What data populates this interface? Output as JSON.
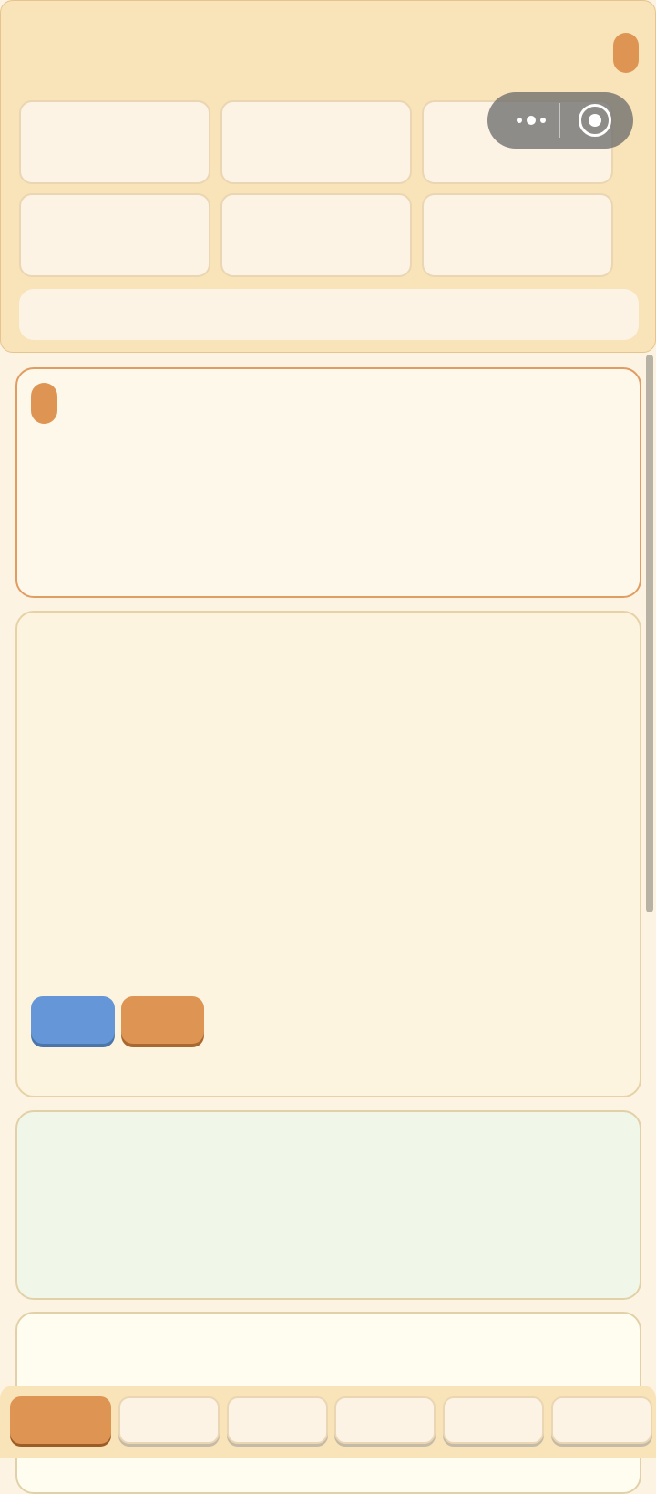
{
  "header": {
    "stats": [
      "",
      "",
      "",
      "",
      "",
      ""
    ],
    "summary": ""
  },
  "capsule": {
    "more_icon": "more-dots-icon",
    "close_icon": "target-circle-icon"
  },
  "cards": {
    "card1_text": "",
    "card2_text": "",
    "card3_text": "",
    "card4_text": ""
  },
  "buttons": {
    "blue_label": "",
    "orange_label": ""
  },
  "tabs": [
    "",
    "",
    "",
    "",
    "",
    ""
  ],
  "colors": {
    "accent_orange": "#de9453",
    "accent_blue": "#6597d8",
    "header_bg": "#f9e3b8",
    "page_bg": "#fdf3e3",
    "green_card_bg": "#f1f7e8"
  }
}
